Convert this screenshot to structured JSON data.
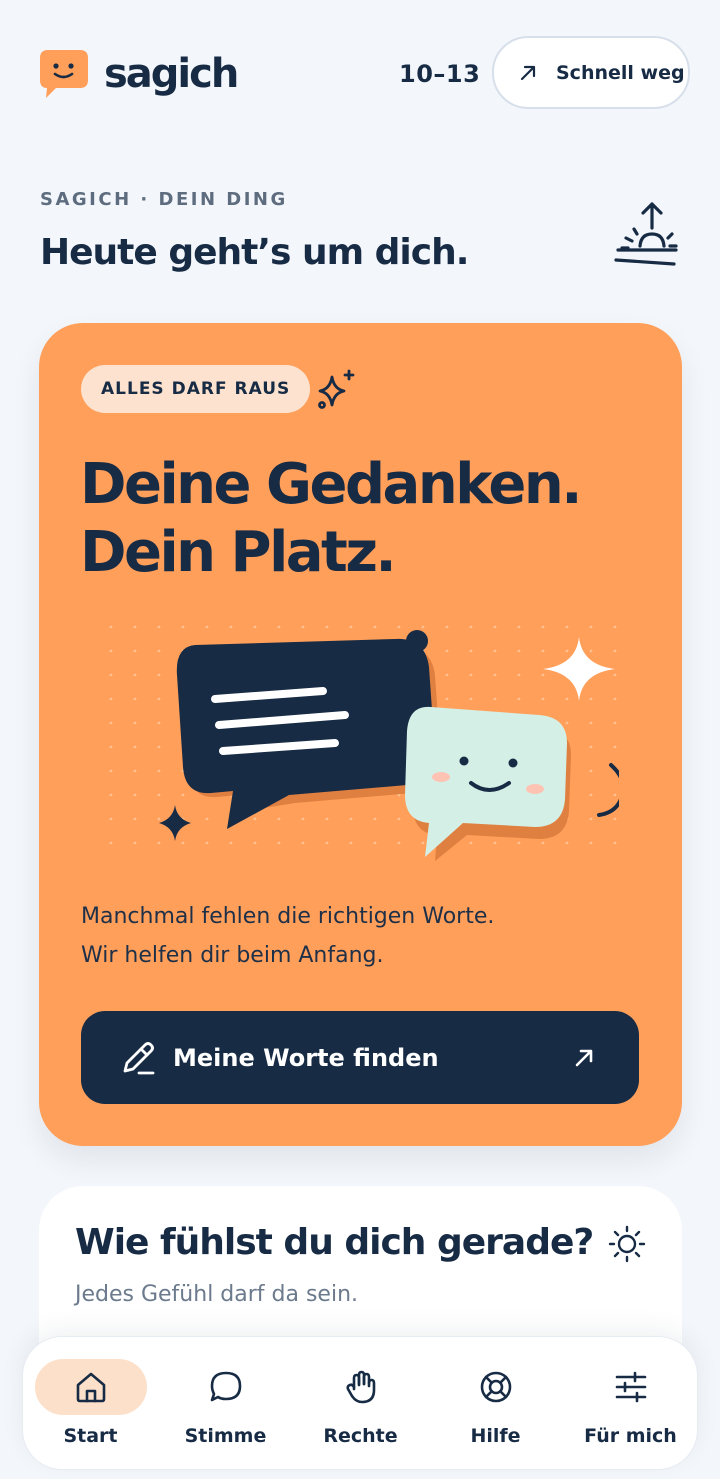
{
  "header": {
    "brand": "sagich",
    "age_range": "10–13",
    "quick_exit_label": "Schnell weg"
  },
  "intro": {
    "eyebrow": "SAGICH · DEIN DING",
    "greeting": "Heute geht’s um dich."
  },
  "hero": {
    "badge": "ALLES DARF RAUS",
    "title_line1": "Deine Gedanken.",
    "title_line2": "Dein Platz.",
    "text_line1": "Manchmal fehlen die richtigen Worte.",
    "text_line2": "Wir helfen dir beim Anfang.",
    "cta_label": "Meine Worte finden",
    "color": "#ff9f5a"
  },
  "mood": {
    "title": "Wie fühlst du dich gerade?",
    "subtitle": "Jedes Gefühl darf da sein."
  },
  "tabs": [
    {
      "label": "Start",
      "icon": "home-icon",
      "active": true
    },
    {
      "label": "Stimme",
      "icon": "chat-bubble-icon",
      "active": false
    },
    {
      "label": "Rechte",
      "icon": "hand-icon",
      "active": false
    },
    {
      "label": "Hilfe",
      "icon": "lifebuoy-icon",
      "active": false
    },
    {
      "label": "Für mich",
      "icon": "sliders-icon",
      "active": false
    }
  ],
  "colors": {
    "navy": "#172b45",
    "orange": "#ff9f5a",
    "mint": "#d4f0e6",
    "background": "#f3f6fa"
  }
}
